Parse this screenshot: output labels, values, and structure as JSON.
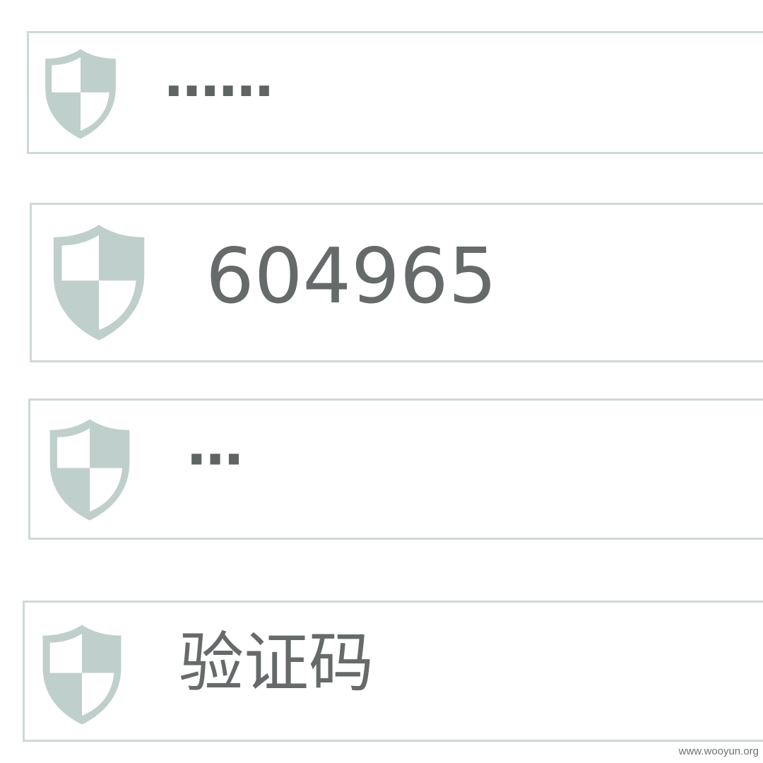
{
  "fields": [
    {
      "icon": "shield-icon",
      "value": "······"
    },
    {
      "icon": "shield-icon",
      "value": "604965"
    },
    {
      "icon": "shield-icon",
      "value": "···"
    },
    {
      "icon": "shield-icon",
      "value": "验证码"
    }
  ],
  "colors": {
    "border": "#cfd9d6",
    "shield": "#bfcfcc",
    "text": "#666a6a"
  },
  "watermark": "www.wooyun.org"
}
